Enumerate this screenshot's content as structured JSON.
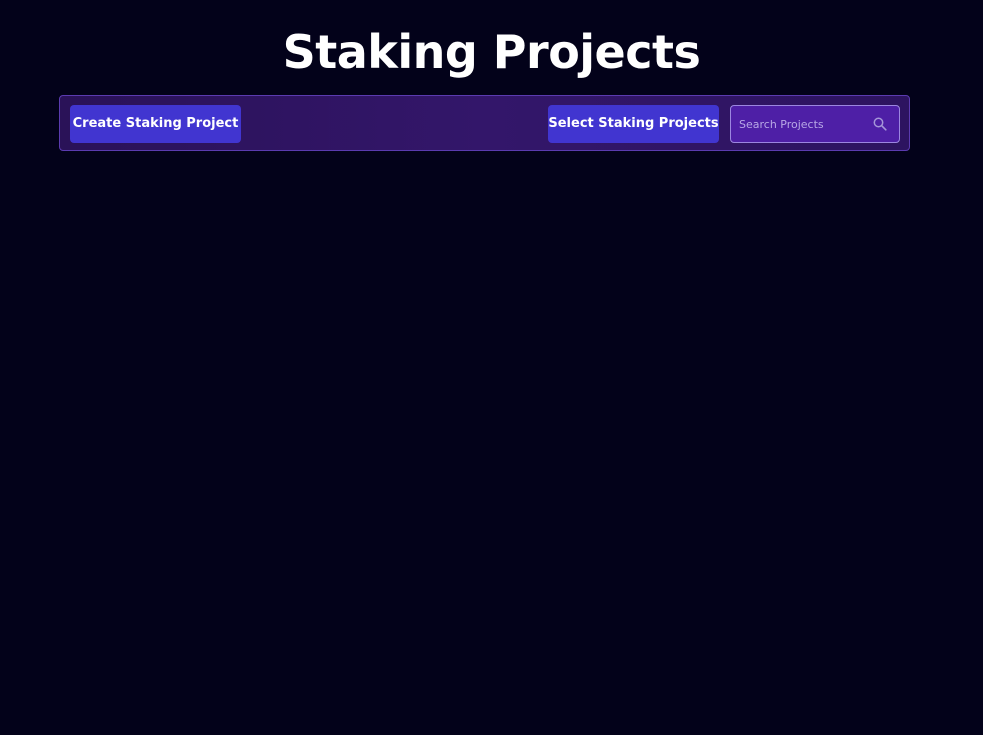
{
  "page": {
    "title": "Staking Projects"
  },
  "toolbar": {
    "create_label": "Create Staking Project",
    "select_label": "Select Staking Projects",
    "search": {
      "placeholder": "Search Projects",
      "value": "",
      "icon": "search-icon"
    }
  },
  "colors": {
    "background": "#03021a",
    "toolbar_background": "#2d1460",
    "toolbar_border": "#5b3bb0",
    "button": "#4135d0",
    "search_background": "#4e1fa6",
    "text": "#ffffff"
  }
}
